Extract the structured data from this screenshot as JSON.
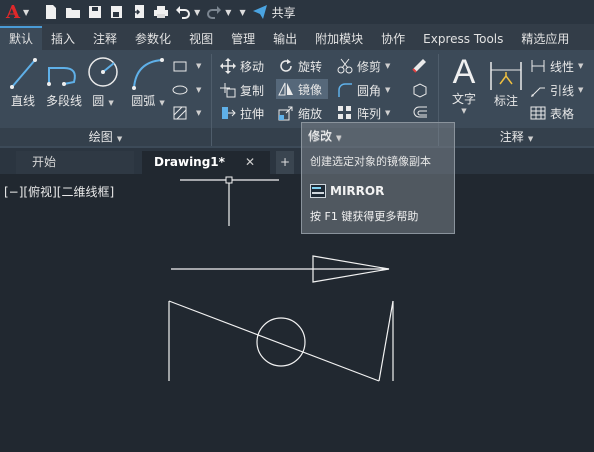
{
  "qat": {
    "share_label": "共享"
  },
  "ribbon_tabs": [
    "默认",
    "插入",
    "注释",
    "参数化",
    "视图",
    "管理",
    "输出",
    "附加模块",
    "协作",
    "Express Tools",
    "精选应用"
  ],
  "draw_panel": {
    "tools": [
      "直线",
      "多段线",
      "圆",
      "圆弧"
    ],
    "footer": "绘图"
  },
  "modify_panel": {
    "col1": [
      "移动",
      "复制",
      "拉伸"
    ],
    "col2": [
      "旋转",
      "镜像",
      "缩放"
    ],
    "col3": [
      "修剪",
      "圆角",
      "阵列"
    ],
    "footer": "修改"
  },
  "annotation_panel": {
    "big": [
      "文字",
      "标注"
    ],
    "small": [
      "线性",
      "引线",
      "表格"
    ],
    "footer": "注释"
  },
  "doc_tabs": {
    "start": "开始",
    "drawing": "Drawing1*"
  },
  "viewport": {
    "label": "[−][俯视][二维线框]"
  },
  "tooltip": {
    "title": "修改",
    "description": "创建选定对象的镜像副本",
    "command": "MIRROR",
    "help": "按 F1 键获得更多帮助"
  },
  "colors": {
    "accent": "#4a9bd6",
    "app_logo": "#e0282a",
    "canvas": "#212830"
  }
}
